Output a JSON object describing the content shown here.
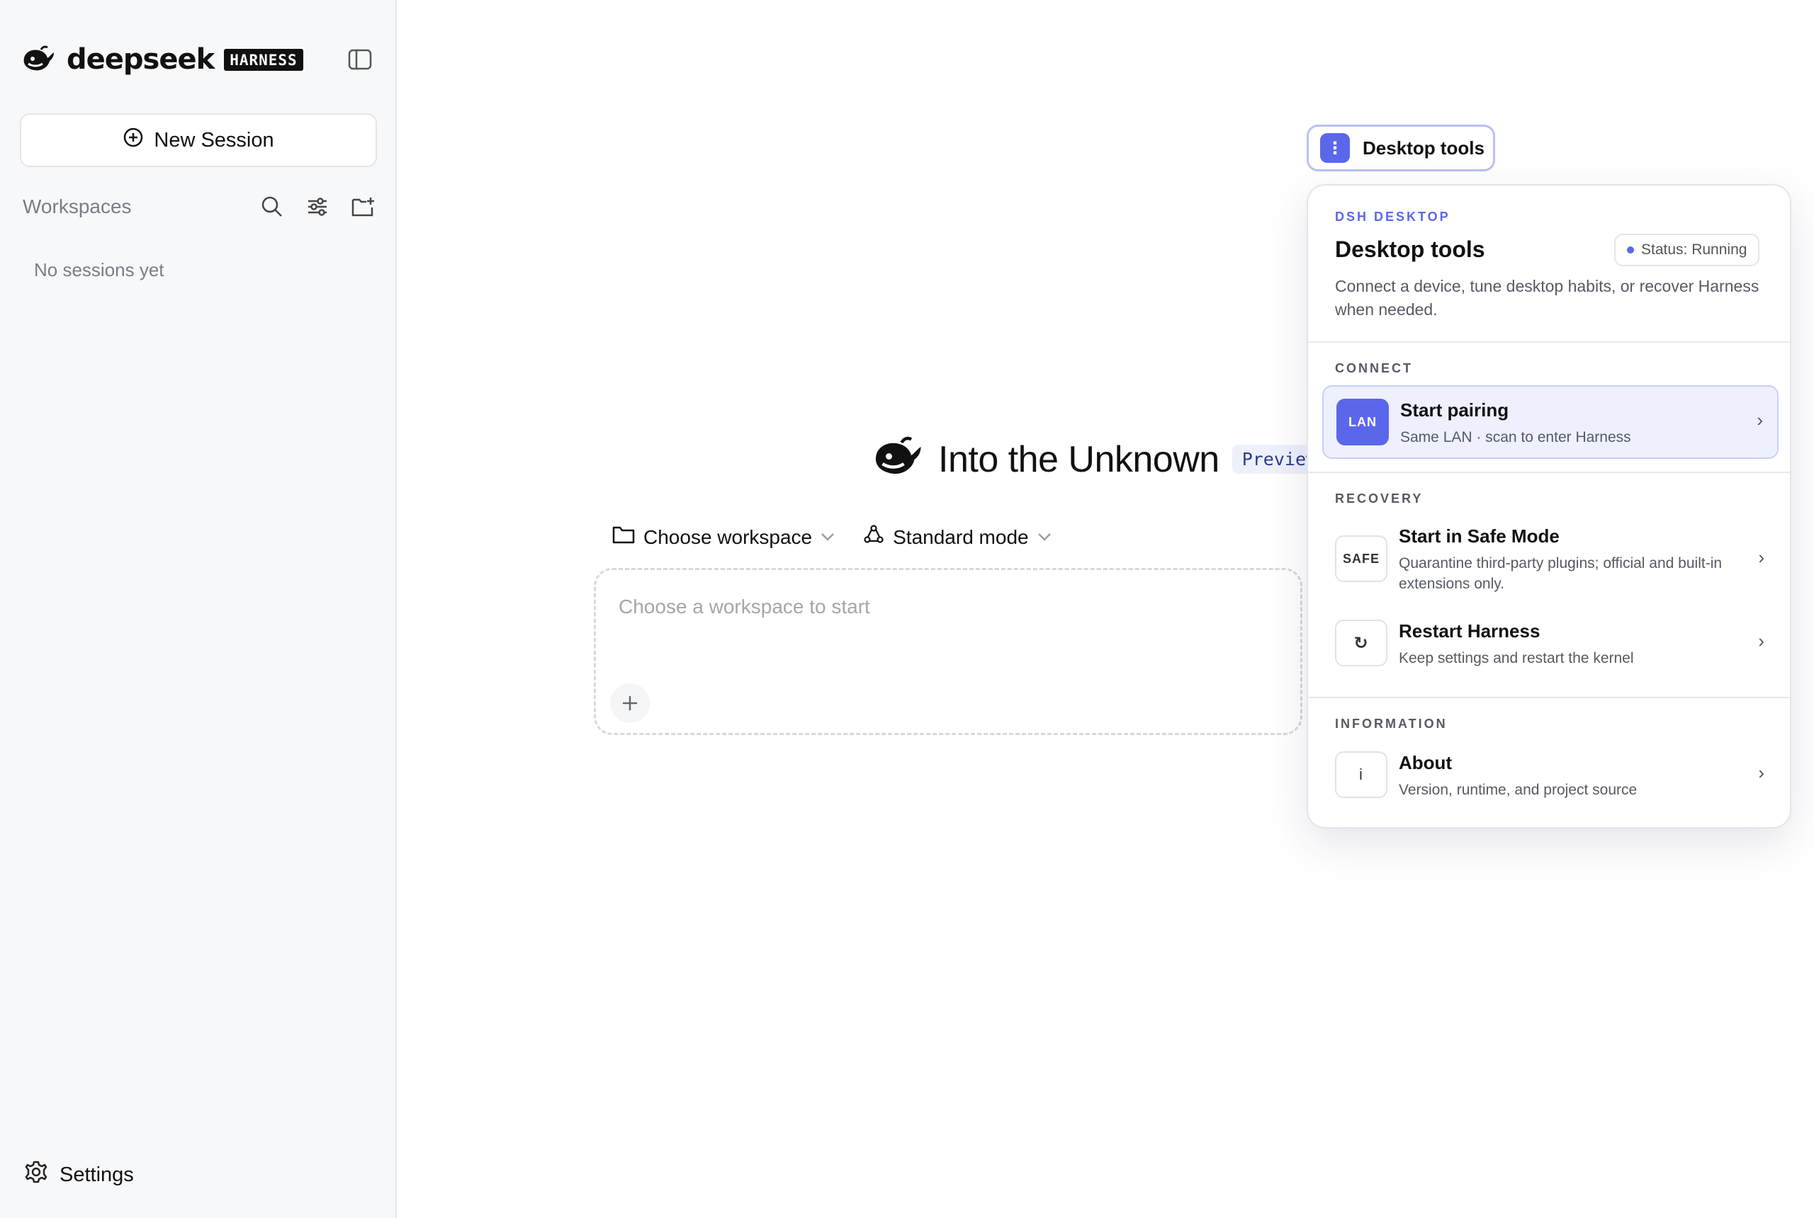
{
  "sidebar": {
    "brand_name": "deepseek",
    "brand_badge": "HARNESS",
    "new_session_label": "New Session",
    "workspaces_title": "Workspaces",
    "empty_label": "No sessions yet",
    "settings_label": "Settings"
  },
  "main": {
    "hero_title": "Into the Unknown",
    "preview_badge": "Preview",
    "workspace_selector": "Choose workspace",
    "mode_selector": "Standard mode",
    "composer_placeholder": "Choose a workspace to start"
  },
  "desktop_tools": {
    "trigger_label": "Desktop tools",
    "eyebrow": "DSH DESKTOP",
    "title": "Desktop tools",
    "status": "Status: Running",
    "description": "Connect a device, tune desktop habits, or recover Harness when needed.",
    "sections": {
      "connect": "CONNECT",
      "recovery": "RECOVERY",
      "information": "INFORMATION"
    },
    "items": [
      {
        "badge": "LAN",
        "title": "Start pairing",
        "subtitle": "Same LAN · scan to enter Harness"
      },
      {
        "badge": "SAFE",
        "title": "Start in Safe Mode",
        "subtitle": "Quarantine third-party plugins; official and built-in extensions only."
      },
      {
        "badge": "↻",
        "title": "Restart Harness",
        "subtitle": "Keep settings and restart the kernel"
      },
      {
        "badge": "i",
        "title": "About",
        "subtitle": "Version, runtime, and project source"
      }
    ]
  },
  "colors": {
    "accent": "#5b67ea",
    "sidebar_bg": "#f7f8fa"
  }
}
